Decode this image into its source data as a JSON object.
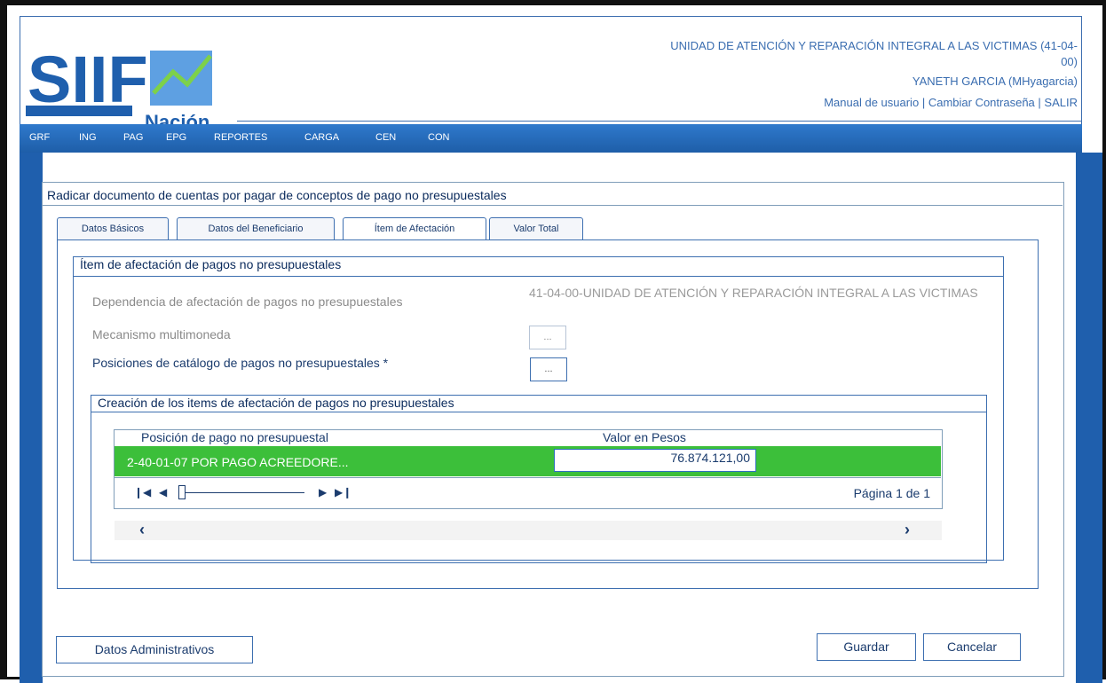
{
  "header": {
    "entity": "UNIDAD DE ATENCIÓN Y REPARACIÓN INTEGRAL A LAS VICTIMAS (41-04-00)",
    "user": "YANETH GARCIA (MHyagarcia)",
    "links": [
      "Manual de usuario",
      "Cambiar Contraseña",
      "SALIR"
    ],
    "separator": "|",
    "logo_text": "SIIF",
    "logo_sub": "Nación"
  },
  "nav": [
    "GRF",
    "ING",
    "PAG",
    "EPG",
    "REPORTES",
    "CARGA",
    "CEN",
    "CON"
  ],
  "page": {
    "title": "Radicar documento de cuentas por pagar de conceptos de pago no presupuestales"
  },
  "tabs": [
    "Datos Básicos",
    "Datos del Beneficiario",
    "Ítem de Afectación",
    "Valor Total"
  ],
  "section": {
    "title": "Ítem de afectación de pagos no presupuestales",
    "dependencia_label": "Dependencia de afectación de pagos no presupuestales",
    "dependencia_value": "41-04-00-UNIDAD DE ATENCIÓN Y REPARACIÓN INTEGRAL A LAS VICTIMAS",
    "multimoneda_label": "Mecanismo multimoneda",
    "posiciones_label": "Posiciones de catálogo de pagos no presupuestales *",
    "dots": "..."
  },
  "subsection": {
    "title": "Creación de los items de afectación de pagos no presupuestales",
    "columns": [
      "Posición de pago no presupuestal",
      "Valor en Pesos"
    ],
    "rows": [
      {
        "posicion": "2-40-01-07 POR PAGO ACREEDORE...",
        "valor": "76.874.121,00"
      }
    ],
    "page_text": "Página 1 de 1"
  },
  "buttons": {
    "datos_admin": "Datos Administrativos",
    "guardar": "Guardar",
    "cancelar": "Cancelar"
  }
}
